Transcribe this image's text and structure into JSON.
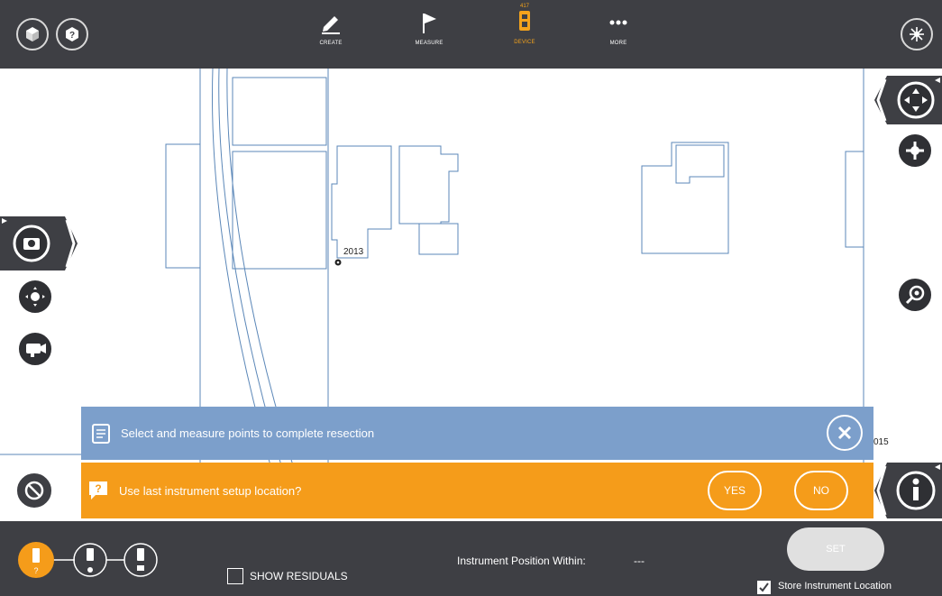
{
  "toolbar": {
    "create_label": "CREATE",
    "measure_label": "MEASURE",
    "device_label": "DEVICE",
    "device_badge": "417",
    "more_label": "MORE"
  },
  "map": {
    "point_label_1": "2013",
    "point_label_2": "015"
  },
  "banners": {
    "info_text": "Select and measure points to complete resection",
    "question_text": "Use last instrument setup location?",
    "yes_label": "YES",
    "no_label": "NO"
  },
  "bottom": {
    "show_residuals_label": "SHOW RESIDUALS",
    "instrument_position_label": "Instrument Position Within:",
    "instrument_position_value": "---",
    "set_label": "SET",
    "store_location_label": "Store Instrument Location",
    "store_location_checked": true
  },
  "colors": {
    "accent": "#f59c1a",
    "info_banner": "#7c9fcb",
    "toolbar": "#3e3f44",
    "linework": "#5b87b8"
  }
}
